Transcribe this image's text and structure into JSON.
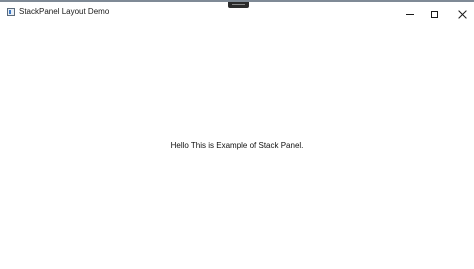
{
  "window": {
    "title": "StackPanel Layout Demo",
    "icon": "app-window-icon",
    "controls": {
      "minimize": "minimize-icon",
      "maximize": "maximize-icon",
      "close": "close-icon"
    }
  },
  "content": {
    "message": "Hello This is Example of Stack Panel."
  }
}
